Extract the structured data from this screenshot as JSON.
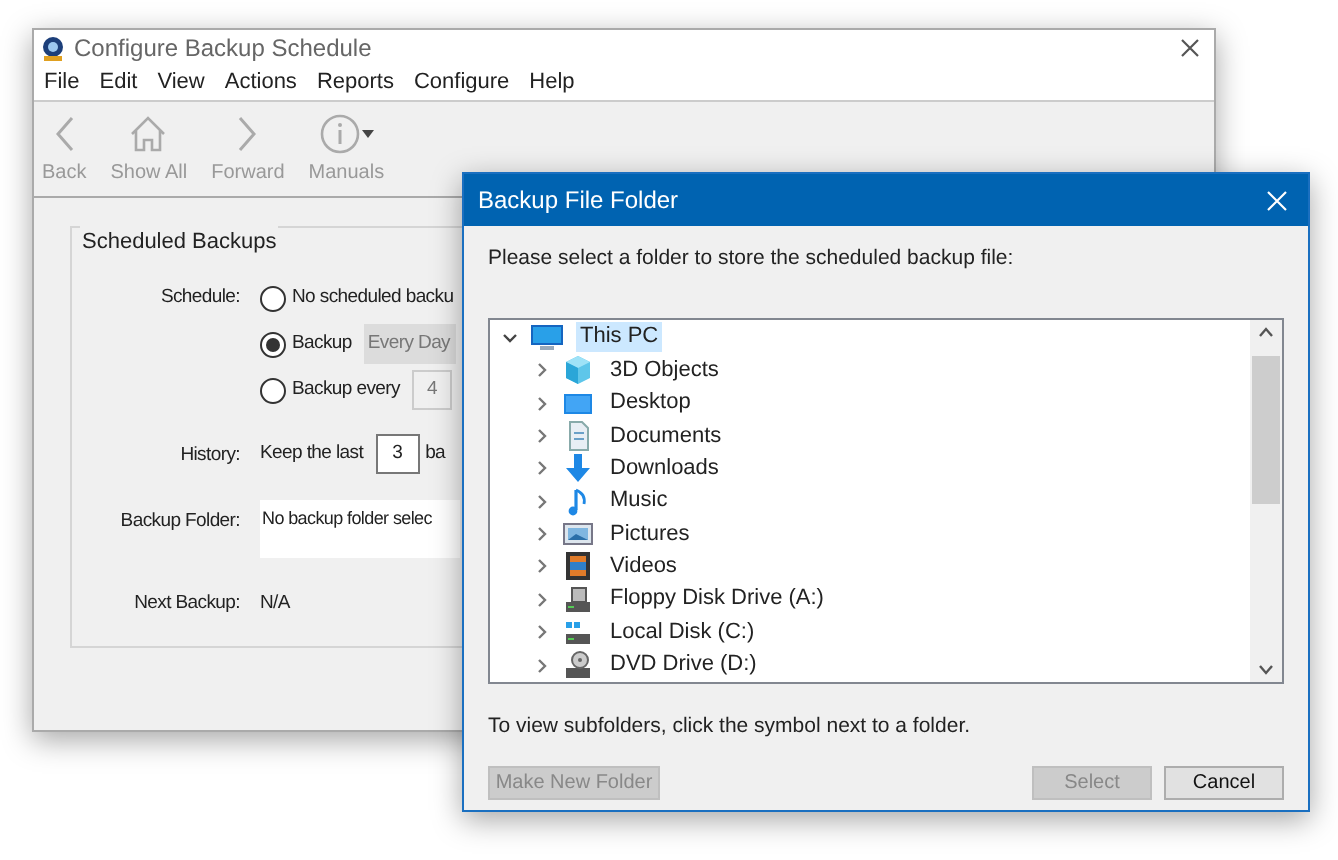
{
  "main_window": {
    "title": "Configure Backup Schedule",
    "menu": [
      "File",
      "Edit",
      "View",
      "Actions",
      "Reports",
      "Configure",
      "Help"
    ],
    "toolbar": [
      {
        "label": "Back",
        "disabled": true
      },
      {
        "label": "Show All",
        "disabled": true
      },
      {
        "label": "Forward",
        "disabled": true
      },
      {
        "label": "Manuals",
        "disabled": true
      }
    ],
    "group": {
      "title": "Scheduled Backups",
      "schedule_label": "Schedule:",
      "schedule_options": [
        {
          "label": "No scheduled backu",
          "selected": false
        },
        {
          "label": "Backup",
          "selected": true,
          "field": "Every Day"
        },
        {
          "label": "Backup every",
          "selected": false,
          "field": "4"
        }
      ],
      "history_label": "History:",
      "history_prefix": "Keep the last",
      "history_value": "3",
      "history_suffix": "ba",
      "folder_label": "Backup Folder:",
      "folder_value": "No backup folder selec",
      "next_label": "Next Backup:",
      "next_value": "N/A"
    }
  },
  "dialog": {
    "title": "Backup File Folder",
    "prompt": "Please select a folder to store the scheduled backup file:",
    "tree": [
      {
        "label": "This PC",
        "expanded": true,
        "selected": true,
        "children": [
          {
            "label": "3D Objects",
            "expanded": false,
            "selected": false
          },
          {
            "label": "Desktop",
            "expanded": false,
            "selected": false
          },
          {
            "label": "Documents",
            "expanded": false,
            "selected": false
          },
          {
            "label": "Downloads",
            "expanded": false,
            "selected": false
          },
          {
            "label": "Music",
            "expanded": false,
            "selected": false
          },
          {
            "label": "Pictures",
            "expanded": false,
            "selected": false
          },
          {
            "label": "Videos",
            "expanded": false,
            "selected": false
          },
          {
            "label": "Floppy Disk Drive (A:)",
            "expanded": false,
            "selected": false
          },
          {
            "label": "Local Disk (C:)",
            "expanded": false,
            "selected": false
          },
          {
            "label": "DVD Drive (D:)",
            "expanded": false,
            "selected": false
          }
        ]
      }
    ],
    "hint": "To view subfolders, click the symbol next to a folder.",
    "buttons": [
      {
        "label": "Make New Folder",
        "disabled": true
      },
      {
        "label": "Select",
        "disabled": true
      },
      {
        "label": "Cancel",
        "disabled": false
      }
    ]
  }
}
